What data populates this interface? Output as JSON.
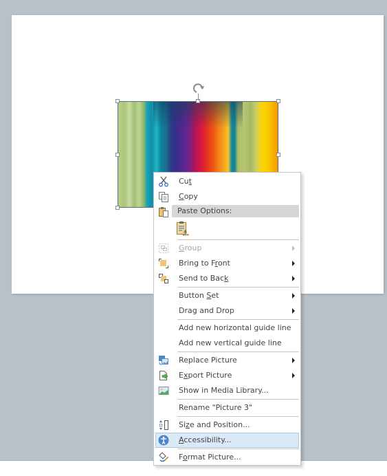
{
  "canvas": {
    "background": "#b8c0c8",
    "slide_background": "#ffffff"
  },
  "picture": {
    "name": "Picture 3",
    "selected": true,
    "selection_color": "#5a6e86"
  },
  "context_menu": {
    "hover_color": "#dce9f6",
    "items": [
      {
        "id": "cut",
        "label_pre": "Cu",
        "label_u": "t",
        "label_post": "",
        "icon": "scissors-icon",
        "submenu": false,
        "enabled": true
      },
      {
        "id": "copy",
        "label_pre": "",
        "label_u": "C",
        "label_post": "opy",
        "icon": "copy-icon",
        "submenu": false,
        "enabled": true
      },
      {
        "id": "paste-options",
        "label": "Paste Options:",
        "icon": "paste-icon",
        "header": true
      },
      {
        "id": "paste-keep-text",
        "icon": "paste-keep-text-only-icon"
      },
      {
        "id": "group",
        "label_pre": "",
        "label_u": "G",
        "label_post": "roup",
        "icon": "group-icon",
        "submenu": true,
        "enabled": false
      },
      {
        "id": "bring-to-front",
        "label_pre": "Bring to F",
        "label_u": "r",
        "label_post": "ont",
        "icon": "bring-to-front-icon",
        "submenu": true,
        "enabled": true
      },
      {
        "id": "send-to-back",
        "label_pre": "Send to Bac",
        "label_u": "k",
        "label_post": "",
        "icon": "send-to-back-icon",
        "submenu": true,
        "enabled": true
      },
      {
        "id": "button-set",
        "label_pre": "Button ",
        "label_u": "S",
        "label_post": "et",
        "submenu": true,
        "enabled": true
      },
      {
        "id": "drag-and-drop",
        "label_pre": "Drag and Drop",
        "label_u": "",
        "label_post": "",
        "submenu": true,
        "enabled": true
      },
      {
        "id": "add-horizontal-guide",
        "label_pre": "Add new horizontal guide line",
        "label_u": "",
        "label_post": "",
        "submenu": false,
        "enabled": true
      },
      {
        "id": "add-vertical-guide",
        "label_pre": "Add new vertical guide line",
        "label_u": "",
        "label_post": "",
        "submenu": false,
        "enabled": true
      },
      {
        "id": "replace-picture",
        "label_pre": "Replace Picture",
        "label_u": "",
        "label_post": "",
        "icon": "replace-picture-icon",
        "submenu": true,
        "enabled": true
      },
      {
        "id": "export-picture",
        "label_pre": "E",
        "label_u": "x",
        "label_post": "port Picture",
        "icon": "export-picture-icon",
        "submenu": true,
        "enabled": true
      },
      {
        "id": "show-in-media-library",
        "label_pre": "Show in Media Library...",
        "label_u": "",
        "label_post": "",
        "icon": "media-library-icon",
        "submenu": false,
        "enabled": true
      },
      {
        "id": "rename",
        "label_pre": "Rename \"Picture 3\"",
        "label_u": "",
        "label_post": "",
        "submenu": false,
        "enabled": true
      },
      {
        "id": "size-and-position",
        "label_pre": "Si",
        "label_u": "z",
        "label_post": "e and Position...",
        "icon": "size-position-icon",
        "submenu": false,
        "enabled": true
      },
      {
        "id": "accessibility",
        "label_pre": "",
        "label_u": "A",
        "label_post": "ccessibility...",
        "icon": "accessibility-icon",
        "submenu": false,
        "enabled": true,
        "hovered": true
      },
      {
        "id": "format-picture",
        "label_pre": "F",
        "label_u": "o",
        "label_post": "rmat Picture...",
        "icon": "format-picture-icon",
        "submenu": false,
        "enabled": true
      }
    ]
  }
}
